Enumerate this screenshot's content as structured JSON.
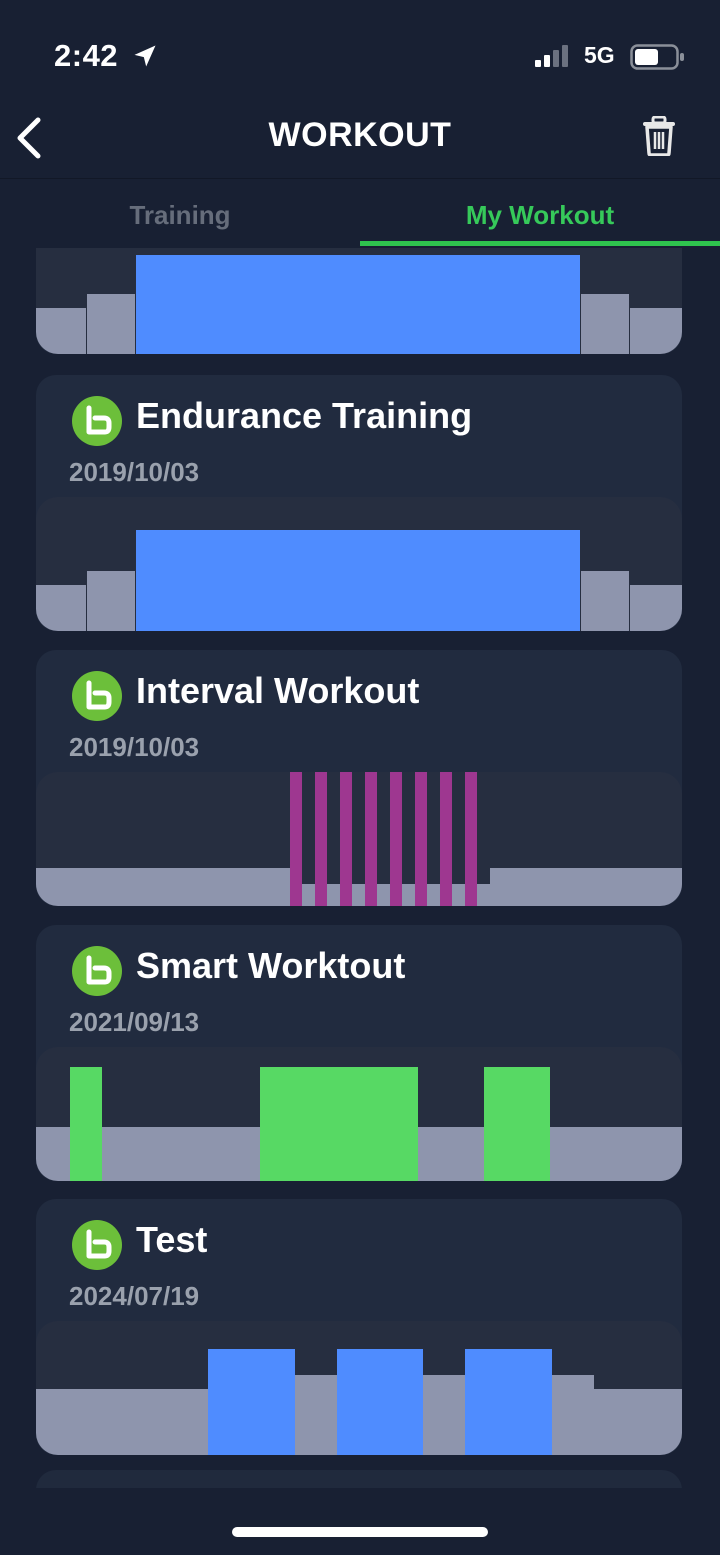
{
  "status_bar": {
    "time": "2:42",
    "network": "5G",
    "icons": [
      "location-arrow-icon",
      "signal-icon",
      "battery-icon"
    ]
  },
  "header": {
    "title": "WORKOUT",
    "back_icon": "chevron-left-icon",
    "trash_icon": "trash-icon"
  },
  "tabs": [
    {
      "label": "Training",
      "active": false
    },
    {
      "label": "My Workout",
      "active": true
    }
  ],
  "colors": {
    "background": "#182033",
    "card": "#212b3f",
    "chart_bg": "#262e40",
    "base_level": "#8e95ad",
    "accent_green": "#2fc44e",
    "blue_interval": "#4f8cff",
    "magenta_interval": "#9e3790",
    "green_interval": "#57d964",
    "logo_green": "#6cbf3a"
  },
  "workouts": [
    {
      "title": "Endurance Training",
      "date": "2019/10/03",
      "logo_icon": "brand-logo-icon"
    },
    {
      "title": "Interval Workout",
      "date": "2019/10/03",
      "logo_icon": "brand-logo-icon"
    },
    {
      "title": "Smart Worktout",
      "date": "2021/09/13",
      "logo_icon": "brand-logo-icon"
    },
    {
      "title": "Test",
      "date": "2024/07/19",
      "logo_icon": "brand-logo-icon"
    }
  ]
}
